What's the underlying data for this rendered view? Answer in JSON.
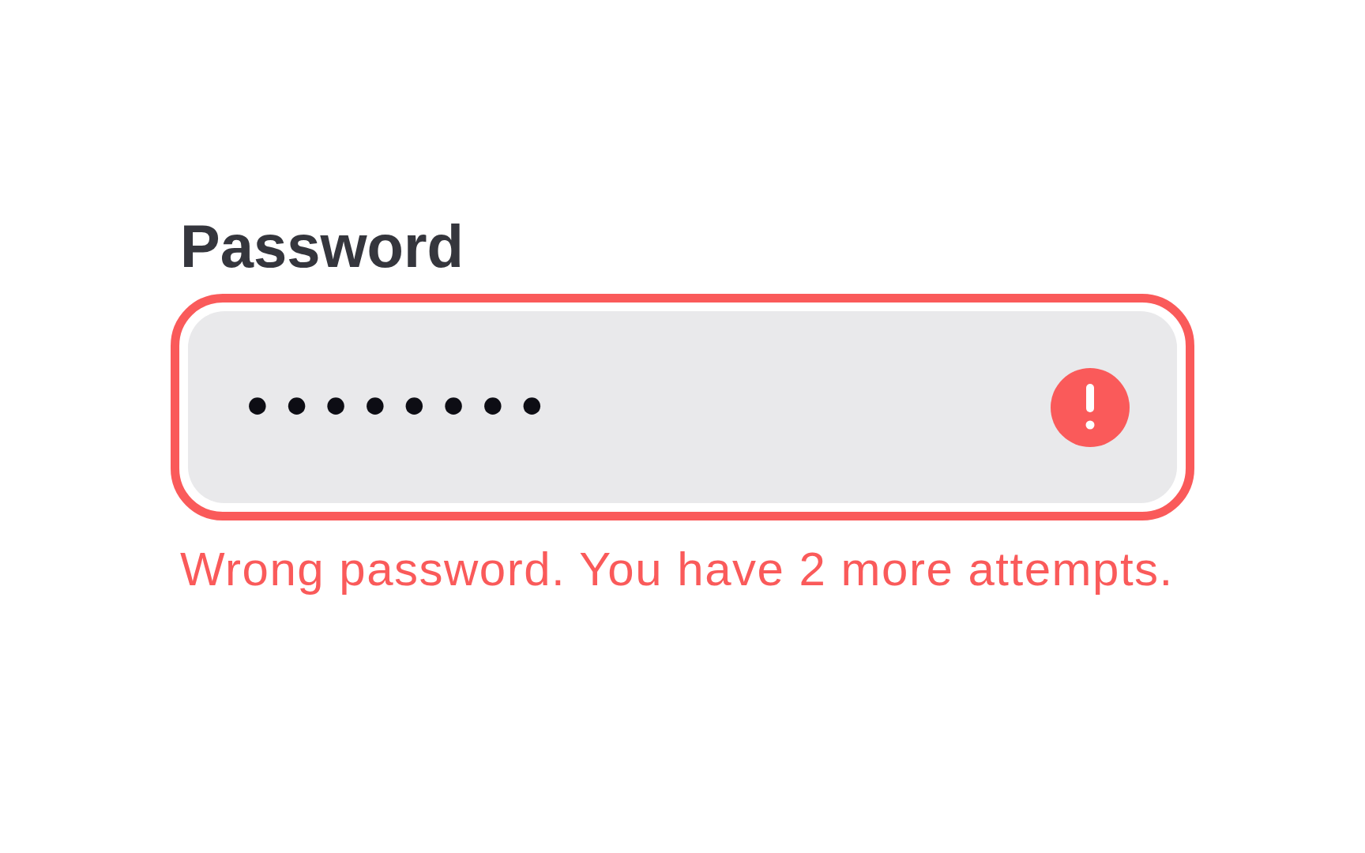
{
  "label": "Password",
  "field": {
    "value": "••••••••",
    "error": true
  },
  "error_message": "Wrong password. You have 2 more attempts."
}
